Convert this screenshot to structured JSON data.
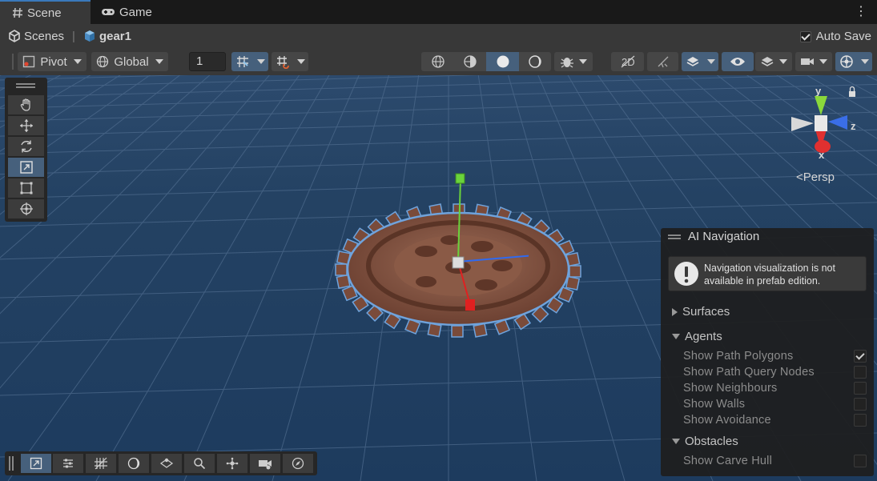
{
  "tabs": [
    {
      "label": "Scene",
      "icon": "hash-icon",
      "active": true
    },
    {
      "label": "Game",
      "icon": "gamepad-icon",
      "active": false
    }
  ],
  "breadcrumb": {
    "root": "Scenes",
    "prefab": "gear1"
  },
  "autosave": {
    "label": "Auto Save",
    "checked": true
  },
  "toolbar": {
    "pivot_label": "Pivot",
    "global_label": "Global",
    "snap_value": "1"
  },
  "tools": [
    "hand-tool-icon",
    "move-tool-icon",
    "rotate-tool-icon",
    "scale-tool-icon",
    "rect-tool-icon",
    "transform-tool-icon"
  ],
  "gizmo": {
    "axis_y": "y",
    "axis_z": "z",
    "axis_x": "x",
    "projection": "Persp"
  },
  "ai_navigation": {
    "title": "AI Navigation",
    "message": "Navigation visualization is not available in prefab edition.",
    "sections": {
      "surfaces": "Surfaces",
      "agents": "Agents",
      "obstacles": "Obstacles"
    },
    "agent_options": [
      {
        "label": "Show Path Polygons",
        "checked": true
      },
      {
        "label": "Show Path Query Nodes",
        "checked": false
      },
      {
        "label": "Show Neighbours",
        "checked": false
      },
      {
        "label": "Show Walls",
        "checked": false
      },
      {
        "label": "Show Avoidance",
        "checked": false
      }
    ],
    "obstacle_options": [
      {
        "label": "Show Carve Hull",
        "checked": false
      }
    ]
  },
  "colors": {
    "accent": "#46607c",
    "panel": "#383838",
    "sky": "#244263",
    "gear": "#8a5a46"
  }
}
